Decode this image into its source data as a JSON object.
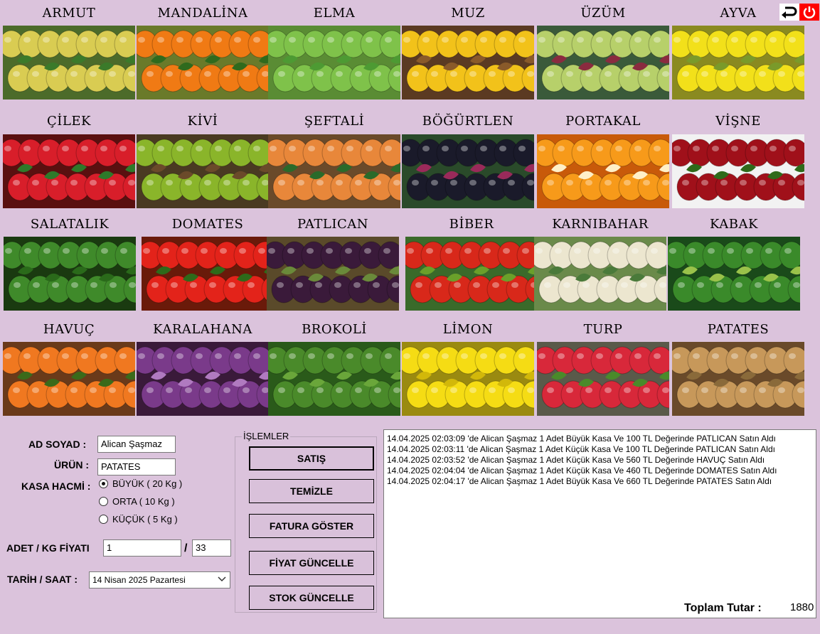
{
  "products": [
    {
      "label": "ARMUT",
      "bg": "#4c6b2a",
      "shape": "#d9cc52",
      "accent": "#3b7a2a"
    },
    {
      "label": "MANDALİNA",
      "bg": "#6a7a2a",
      "shape": "#f07a14",
      "accent": "#2f6a1d"
    },
    {
      "label": "ELMA",
      "bg": "#5a8c34",
      "shape": "#7fc24a",
      "accent": "#4d9a33"
    },
    {
      "label": "MUZ",
      "bg": "#5b3a22",
      "shape": "#f2c21a",
      "accent": "#8a5a2a"
    },
    {
      "label": "ÜZÜM",
      "bg": "#3a5a3a",
      "shape": "#b7d06a",
      "accent": "#8a2b3f"
    },
    {
      "label": "AYVA",
      "bg": "#8a8a20",
      "shape": "#f2e01a",
      "accent": "#7a9a2a"
    },
    {
      "label": "ÇİLEK",
      "bg": "#5a1010",
      "shape": "#d81e2a",
      "accent": "#2e7a2a"
    },
    {
      "label": "KİVİ",
      "bg": "#4a3a22",
      "shape": "#8ab52a",
      "accent": "#6b4a2a"
    },
    {
      "label": "ŞEFTALİ",
      "bg": "#6a4a2a",
      "shape": "#e8873a",
      "accent": "#2a6a2a"
    },
    {
      "label": "BÖĞÜRTLEN",
      "bg": "#2a4a2a",
      "shape": "#1a1a2a",
      "accent": "#9a2a5a"
    },
    {
      "label": "PORTAKAL",
      "bg": "#c85a0a",
      "shape": "#f79a1a",
      "accent": "#fff0c8"
    },
    {
      "label": "VİŞNE",
      "bg": "#f2f2f2",
      "shape": "#a0101a",
      "accent": "#2e6a1a"
    },
    {
      "label": "SALATALIK",
      "bg": "#1a3a10",
      "shape": "#3f8a2a",
      "accent": "#2a6a1a"
    },
    {
      "label": "DOMATES",
      "bg": "#6a1a0a",
      "shape": "#e3231a",
      "accent": "#2e6a1a"
    },
    {
      "label": "PATLICAN",
      "bg": "#5a4a2a",
      "shape": "#3a1a3a",
      "accent": "#6a8a3a"
    },
    {
      "label": "BİBER",
      "bg": "#3a6a2a",
      "shape": "#d8281a",
      "accent": "#6aa02a"
    },
    {
      "label": "KARNIBAHAR",
      "bg": "#6a8a4a",
      "shape": "#ece6cf",
      "accent": "#4a7a3a"
    },
    {
      "label": "KABAK",
      "bg": "#1a4a1a",
      "shape": "#3a8a2a",
      "accent": "#9ac24a"
    },
    {
      "label": "HAVUÇ",
      "bg": "#6a3a1a",
      "shape": "#f07820",
      "accent": "#3a6a1a"
    },
    {
      "label": "KARALAHANA",
      "bg": "#3a1a3a",
      "shape": "#7a3a8a",
      "accent": "#b07ac0"
    },
    {
      "label": "BROKOLİ",
      "bg": "#2a5a1a",
      "shape": "#4a8a2a",
      "accent": "#6aa63a"
    },
    {
      "label": "LİMON",
      "bg": "#9a8a10",
      "shape": "#f5dc14",
      "accent": "#d2b80a"
    },
    {
      "label": "TURP",
      "bg": "#5a5a4a",
      "shape": "#d8283a",
      "accent": "#4a8a2a"
    },
    {
      "label": "PATATES",
      "bg": "#6a4a2a",
      "shape": "#c7985a",
      "accent": "#8a6a3a"
    }
  ],
  "icons": {
    "back": "undo-arrow-icon",
    "power": "power-icon"
  },
  "form": {
    "ad_soyad_label": "AD SOYAD :",
    "ad_soyad_value": "Alican Şaşmaz",
    "urun_label": "ÜRÜN :",
    "urun_value": "PATATES",
    "kasa_label": "KASA HACMİ :",
    "kasa_options": [
      "BÜYÜK ( 20 Kg )",
      "ORTA ( 10 Kg )",
      "KÜÇÜK ( 5 Kg )"
    ],
    "kasa_selected": 0,
    "adet_label": "ADET / KG FİYATI",
    "adet_value": "1",
    "slash": "/",
    "fiyat_value": "33",
    "tarih_label": "TARİH / SAAT :",
    "tarih_value": "14  Nisan   2025  Pazartesi"
  },
  "operations": {
    "title": "İŞLEMLER",
    "buttons": [
      "SATIŞ",
      "TEMİZLE",
      "FATURA GÖSTER",
      "FİYAT GÜNCELLE",
      "STOK GÜNCELLE"
    ]
  },
  "log_lines": [
    "14.04.2025 02:03:09 'de Alican Şaşmaz 1 Adet Büyük Kasa Ve 100 TL Değerinde  PATLICAN  Satın Aldı",
    "14.04.2025 02:03:11 'de Alican Şaşmaz 1 Adet Küçük Kasa Ve 100 TL Değerinde  PATLICAN  Satın Aldı",
    "14.04.2025 02:03:52 'de Alican Şaşmaz 1 Adet Küçük Kasa Ve 560 TL Değerinde  HAVUÇ  Satın Aldı",
    "14.04.2025 02:04:04 'de Alican Şaşmaz 1 Adet Küçük Kasa Ve 460 TL Değerinde  DOMATES  Satın Aldı",
    "14.04.2025 02:04:17 'de Alican Şaşmaz 1 Adet Büyük Kasa Ve 660 TL Değerinde  PATATES  Satın Aldı"
  ],
  "total": {
    "label": "Toplam Tutar :",
    "value": "1880"
  }
}
